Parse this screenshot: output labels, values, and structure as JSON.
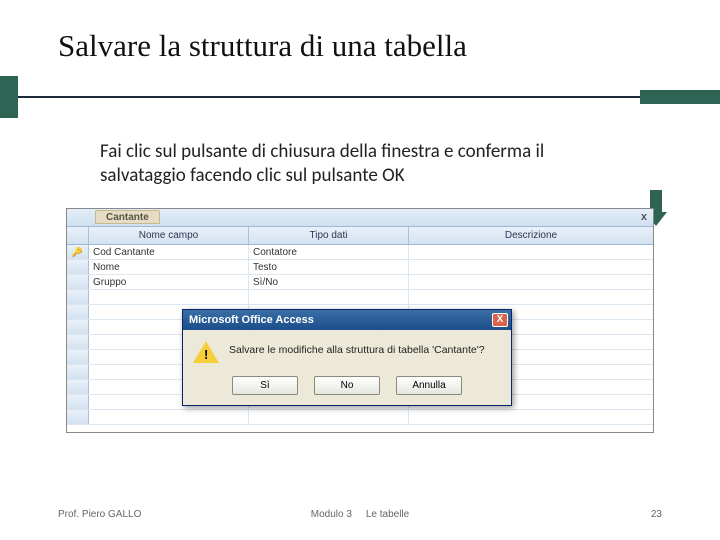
{
  "title": "Salvare la struttura di una tabella",
  "body": "Fai clic sul pulsante di chiusura della finestra e conferma il salvataggio facendo clic sul pulsante OK",
  "screenshot": {
    "tab_name": "Cantante",
    "close_x": "x",
    "columns": {
      "name": "Nome campo",
      "type": "Tipo dati",
      "desc": "Descrizione"
    },
    "rows": [
      {
        "key": "🔑",
        "name": "Cod Cantante",
        "type": "Contatore"
      },
      {
        "key": "",
        "name": "Nome",
        "type": "Testo"
      },
      {
        "key": "",
        "name": "Gruppo",
        "type": "Sì/No"
      }
    ],
    "dialog": {
      "title": "Microsoft Office Access",
      "close": "X",
      "message": "Salvare le modifiche alla struttura di tabella 'Cantante'?",
      "buttons": {
        "yes": "Sì",
        "no": "No",
        "cancel": "Annulla"
      }
    }
  },
  "footer": {
    "left": "Prof. Piero GALLO",
    "center_module": "Modulo 3",
    "center_topic": "Le tabelle",
    "page": "23"
  }
}
